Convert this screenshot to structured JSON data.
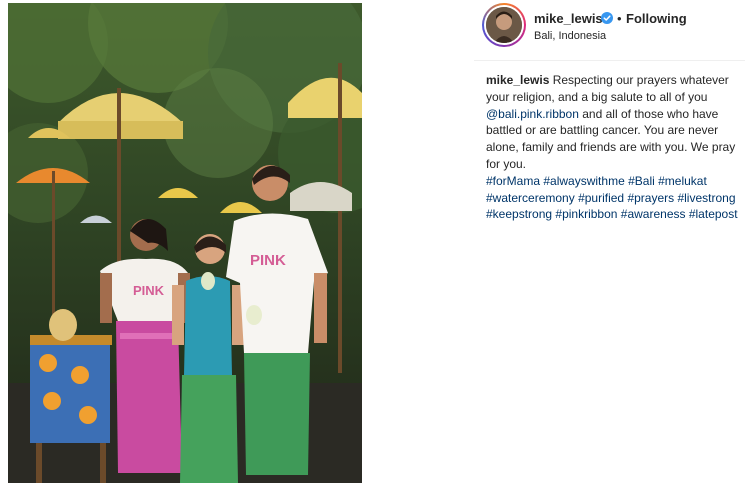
{
  "post": {
    "username": "mike_lewis",
    "follow_separator": "•",
    "follow_state": "Following",
    "location": "Bali, Indonesia",
    "verified_icon": "verified-badge-icon",
    "accent_color": "#3897f0",
    "link_color": "#003569"
  },
  "caption": {
    "username": "mike_lewis",
    "text_part1": "Respecting our prayers whatever your religion, and a big salute to all of you",
    "mention": "@bali.pink.ribbon",
    "text_part2": "and all of those who have battled or are battling cancer. You are never alone, family and friends are with you. We pray for you.",
    "hashtags": [
      "#forMama",
      "#alwayswithme",
      "#Bali",
      "#melukat",
      "#waterceremony",
      "#purified",
      "#prayers",
      "#livestrong",
      "#keepstrong",
      "#pinkribbon",
      "#awareness",
      "#latepost"
    ]
  },
  "photo": {
    "shirt_text": "PINK"
  }
}
